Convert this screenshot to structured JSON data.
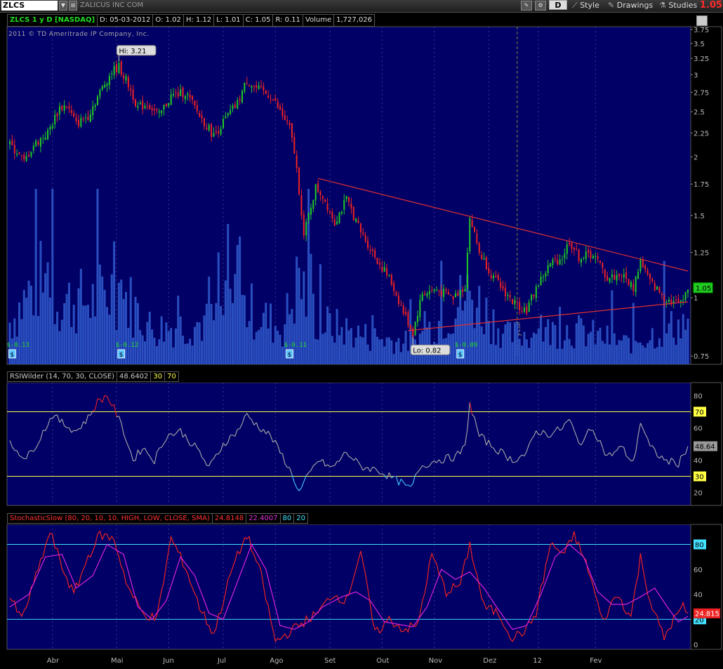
{
  "toolbar": {
    "symbol": "ZLCS",
    "company_name": "ZALICUS INC COM",
    "aggregation": "D",
    "style_label": "Style",
    "drawings_label": "Drawings",
    "studies_label": "Studies",
    "last_price": "1.05"
  },
  "info_bar": {
    "title": "ZLCS 1 y D [NASDAQ]",
    "date": "D: 05-03-2012",
    "open": "O: 1.02",
    "high": "H: 1.12",
    "low": "L: 1.01",
    "close": "C: 1.05",
    "range": "R: 0.11",
    "volume_label": "Volume",
    "volume_value": "1,727,026"
  },
  "copyright": "2011 © TD Ameritrade IP Company, Inc.",
  "colors": {
    "background": "#000066",
    "up": "#22cc22",
    "down": "#ee2222",
    "volume": "#2a4fc0",
    "trend": "#e03030",
    "rsi_line": "#aaaaaa",
    "overbought": "#ffff44",
    "stoch_k": "#ee2222",
    "stoch_d": "#dd22dd",
    "stoch_levels": "#44e0ff"
  },
  "rsi_legend": {
    "study": "RSIWilder (14, 70, 30, CLOSE)",
    "value": "48.6402",
    "oversold": "30",
    "overbought": "70"
  },
  "stoch_legend": {
    "study": "StochasticSlow (80, 20, 10, 10, HIGH, LOW, CLOSE, SMA)",
    "k_value": "24.8148",
    "d_value": "22.4007",
    "overbought": "80",
    "oversold": "20"
  },
  "chart_data": [
    {
      "type": "candlestick",
      "title": "ZLCS 1 y D [NASDAQ]",
      "x_labels": [
        "Abr",
        "Mai",
        "Jun",
        "Jul",
        "Ago",
        "Set",
        "Out",
        "Nov",
        "Dez",
        "12",
        "Fev"
      ],
      "year_marker": "2011 year",
      "y_ticks": [
        "3.75",
        "3.5",
        "3.25",
        "3",
        "2.75",
        "2.5",
        "2.25",
        "2",
        "1.75",
        "1.5",
        "1.25",
        "1",
        "0.75"
      ],
      "y_scale": "log",
      "y_range": [
        0.72,
        3.8
      ],
      "anchors": [
        {
          "d": 0,
          "p": 2.12
        },
        {
          "d": 3,
          "p": 2.05
        },
        {
          "d": 6,
          "p": 1.95
        },
        {
          "d": 10,
          "p": 2.12
        },
        {
          "d": 16,
          "p": 2.25
        },
        {
          "d": 21,
          "p": 2.55
        },
        {
          "d": 24,
          "p": 2.58
        },
        {
          "d": 28,
          "p": 2.35
        },
        {
          "d": 33,
          "p": 2.45
        },
        {
          "d": 38,
          "p": 2.75
        },
        {
          "d": 43,
          "p": 3.05
        },
        {
          "d": 46,
          "p": 3.12
        },
        {
          "d": 50,
          "p": 2.85
        },
        {
          "d": 54,
          "p": 2.55
        },
        {
          "d": 58,
          "p": 2.6
        },
        {
          "d": 63,
          "p": 2.45
        },
        {
          "d": 68,
          "p": 2.7
        },
        {
          "d": 74,
          "p": 2.75
        },
        {
          "d": 80,
          "p": 2.45
        },
        {
          "d": 86,
          "p": 2.22
        },
        {
          "d": 92,
          "p": 2.45
        },
        {
          "d": 96,
          "p": 2.6
        },
        {
          "d": 100,
          "p": 2.92
        },
        {
          "d": 104,
          "p": 2.8
        },
        {
          "d": 110,
          "p": 2.7
        },
        {
          "d": 114,
          "p": 2.5
        },
        {
          "d": 118,
          "p": 2.3
        },
        {
          "d": 120,
          "p": 2.05
        },
        {
          "d": 122,
          "p": 1.7
        },
        {
          "d": 124,
          "p": 1.35
        },
        {
          "d": 126,
          "p": 1.5
        },
        {
          "d": 129,
          "p": 1.72
        },
        {
          "d": 132,
          "p": 1.65
        },
        {
          "d": 137,
          "p": 1.45
        },
        {
          "d": 142,
          "p": 1.62
        },
        {
          "d": 148,
          "p": 1.38
        },
        {
          "d": 155,
          "p": 1.2
        },
        {
          "d": 160,
          "p": 1.1
        },
        {
          "d": 166,
          "p": 0.93
        },
        {
          "d": 170,
          "p": 0.84
        },
        {
          "d": 174,
          "p": 1.02
        },
        {
          "d": 180,
          "p": 1.04
        },
        {
          "d": 187,
          "p": 1.0
        },
        {
          "d": 192,
          "p": 1.06
        },
        {
          "d": 194,
          "p": 1.48
        },
        {
          "d": 198,
          "p": 1.25
        },
        {
          "d": 204,
          "p": 1.1
        },
        {
          "d": 212,
          "p": 0.98
        },
        {
          "d": 218,
          "p": 0.94
        },
        {
          "d": 222,
          "p": 1.05
        },
        {
          "d": 228,
          "p": 1.18
        },
        {
          "d": 233,
          "p": 1.22
        },
        {
          "d": 236,
          "p": 1.32
        },
        {
          "d": 240,
          "p": 1.22
        },
        {
          "d": 246,
          "p": 1.24
        },
        {
          "d": 252,
          "p": 1.1
        },
        {
          "d": 258,
          "p": 1.12
        },
        {
          "d": 263,
          "p": 1.05
        },
        {
          "d": 266,
          "p": 1.2
        },
        {
          "d": 270,
          "p": 1.08
        },
        {
          "d": 276,
          "p": 1.0
        },
        {
          "d": 282,
          "p": 0.97
        },
        {
          "d": 286,
          "p": 1.05
        }
      ],
      "volume_anchors": [
        {
          "d": 0,
          "v": 0.3
        },
        {
          "d": 12,
          "v": 0.6
        },
        {
          "d": 20,
          "v": 0.45
        },
        {
          "d": 35,
          "v": 0.45
        },
        {
          "d": 45,
          "v": 0.55
        },
        {
          "d": 60,
          "v": 0.25
        },
        {
          "d": 85,
          "v": 0.3
        },
        {
          "d": 95,
          "v": 0.45
        },
        {
          "d": 115,
          "v": 0.25
        },
        {
          "d": 122,
          "v": 0.6
        },
        {
          "d": 130,
          "v": 0.3
        },
        {
          "d": 150,
          "v": 0.2
        },
        {
          "d": 170,
          "v": 0.15
        },
        {
          "d": 194,
          "v": 0.5
        },
        {
          "d": 210,
          "v": 0.2
        },
        {
          "d": 236,
          "v": 0.25
        },
        {
          "d": 260,
          "v": 0.15
        },
        {
          "d": 286,
          "v": 0.3
        }
      ],
      "volume_spikes": [
        {
          "d": 18,
          "v": 1.0
        },
        {
          "d": 92,
          "v": 0.8
        },
        {
          "d": 96,
          "v": 0.68
        },
        {
          "d": 122,
          "v": 0.55
        },
        {
          "d": 194,
          "v": 0.42
        },
        {
          "d": 263,
          "v": 0.35
        }
      ],
      "annotations": [
        {
          "label": "Hi: 3.21",
          "d": 46,
          "p": 3.21
        },
        {
          "label": "Lo: 0.82",
          "d": 170,
          "p": 0.82
        }
      ],
      "dividends": [
        {
          "label": "$-0.13",
          "d": 1
        },
        {
          "label": "$-0.12",
          "d": 47
        },
        {
          "label": "$-0.11",
          "d": 118
        },
        {
          "label": "$-0.09",
          "d": 190
        }
      ],
      "trendlines": [
        {
          "from": {
            "d": 130,
            "p": 1.8
          },
          "to": {
            "d": 286,
            "p": 1.14
          }
        },
        {
          "from": {
            "d": 168,
            "p": 0.85
          },
          "to": {
            "d": 286,
            "p": 0.98
          }
        }
      ],
      "last_label": "1.05"
    },
    {
      "type": "line",
      "title": "RSIWilder (14, 70, 30, CLOSE)",
      "y_ticks": [
        "80",
        "60",
        "40",
        "20"
      ],
      "y_range": [
        12,
        88
      ],
      "levels": [
        {
          "value": 70,
          "label": "70"
        },
        {
          "value": 30,
          "label": "30"
        }
      ],
      "anchors": [
        {
          "d": 0,
          "v": 50
        },
        {
          "d": 7,
          "v": 41
        },
        {
          "d": 12,
          "v": 52
        },
        {
          "d": 18,
          "v": 68
        },
        {
          "d": 23,
          "v": 62
        },
        {
          "d": 28,
          "v": 58
        },
        {
          "d": 33,
          "v": 66
        },
        {
          "d": 37,
          "v": 76
        },
        {
          "d": 41,
          "v": 80
        },
        {
          "d": 44,
          "v": 72
        },
        {
          "d": 48,
          "v": 58
        },
        {
          "d": 52,
          "v": 40
        },
        {
          "d": 56,
          "v": 48
        },
        {
          "d": 61,
          "v": 40
        },
        {
          "d": 66,
          "v": 55
        },
        {
          "d": 72,
          "v": 58
        },
        {
          "d": 80,
          "v": 45
        },
        {
          "d": 84,
          "v": 35
        },
        {
          "d": 90,
          "v": 50
        },
        {
          "d": 96,
          "v": 58
        },
        {
          "d": 100,
          "v": 68
        },
        {
          "d": 104,
          "v": 62
        },
        {
          "d": 110,
          "v": 55
        },
        {
          "d": 116,
          "v": 40
        },
        {
          "d": 120,
          "v": 28
        },
        {
          "d": 122,
          "v": 20
        },
        {
          "d": 125,
          "v": 28
        },
        {
          "d": 130,
          "v": 40
        },
        {
          "d": 136,
          "v": 35
        },
        {
          "d": 142,
          "v": 45
        },
        {
          "d": 148,
          "v": 36
        },
        {
          "d": 155,
          "v": 34
        },
        {
          "d": 160,
          "v": 30
        },
        {
          "d": 165,
          "v": 26
        },
        {
          "d": 169,
          "v": 22
        },
        {
          "d": 173,
          "v": 36
        },
        {
          "d": 180,
          "v": 40
        },
        {
          "d": 188,
          "v": 42
        },
        {
          "d": 192,
          "v": 48
        },
        {
          "d": 194,
          "v": 75
        },
        {
          "d": 198,
          "v": 55
        },
        {
          "d": 204,
          "v": 48
        },
        {
          "d": 212,
          "v": 40
        },
        {
          "d": 218,
          "v": 44
        },
        {
          "d": 222,
          "v": 58
        },
        {
          "d": 228,
          "v": 56
        },
        {
          "d": 233,
          "v": 60
        },
        {
          "d": 236,
          "v": 65
        },
        {
          "d": 240,
          "v": 50
        },
        {
          "d": 246,
          "v": 60
        },
        {
          "d": 252,
          "v": 42
        },
        {
          "d": 258,
          "v": 48
        },
        {
          "d": 263,
          "v": 38
        },
        {
          "d": 266,
          "v": 64
        },
        {
          "d": 270,
          "v": 48
        },
        {
          "d": 276,
          "v": 40
        },
        {
          "d": 282,
          "v": 38
        },
        {
          "d": 286,
          "v": 48.64
        }
      ],
      "last_label": "48.64"
    },
    {
      "type": "line",
      "title": "StochasticSlow (80, 20, 10, 10, HIGH, LOW, CLOSE, SMA)",
      "y_ticks": [
        "80",
        "60",
        "40",
        "20",
        "0"
      ],
      "y_range": [
        -4,
        96
      ],
      "levels": [
        {
          "value": 80,
          "label": "80"
        },
        {
          "value": 20,
          "label": "20"
        }
      ],
      "series": [
        {
          "name": "SlowK",
          "anchors": [
            {
              "d": 0,
              "v": 38
            },
            {
              "d": 5,
              "v": 20
            },
            {
              "d": 10,
              "v": 48
            },
            {
              "d": 17,
              "v": 90
            },
            {
              "d": 22,
              "v": 62
            },
            {
              "d": 27,
              "v": 40
            },
            {
              "d": 33,
              "v": 70
            },
            {
              "d": 38,
              "v": 88
            },
            {
              "d": 44,
              "v": 84
            },
            {
              "d": 50,
              "v": 45
            },
            {
              "d": 56,
              "v": 25
            },
            {
              "d": 62,
              "v": 20
            },
            {
              "d": 68,
              "v": 85
            },
            {
              "d": 74,
              "v": 62
            },
            {
              "d": 80,
              "v": 30
            },
            {
              "d": 86,
              "v": 8
            },
            {
              "d": 94,
              "v": 62
            },
            {
              "d": 100,
              "v": 88
            },
            {
              "d": 106,
              "v": 55
            },
            {
              "d": 112,
              "v": 2
            },
            {
              "d": 118,
              "v": 10
            },
            {
              "d": 124,
              "v": 18
            },
            {
              "d": 130,
              "v": 25
            },
            {
              "d": 136,
              "v": 40
            },
            {
              "d": 142,
              "v": 35
            },
            {
              "d": 148,
              "v": 75
            },
            {
              "d": 154,
              "v": 8
            },
            {
              "d": 160,
              "v": 20
            },
            {
              "d": 166,
              "v": 12
            },
            {
              "d": 172,
              "v": 15
            },
            {
              "d": 178,
              "v": 72
            },
            {
              "d": 184,
              "v": 42
            },
            {
              "d": 190,
              "v": 48
            },
            {
              "d": 194,
              "v": 80
            },
            {
              "d": 200,
              "v": 30
            },
            {
              "d": 206,
              "v": 25
            },
            {
              "d": 212,
              "v": 5
            },
            {
              "d": 218,
              "v": 12
            },
            {
              "d": 222,
              "v": 25
            },
            {
              "d": 228,
              "v": 80
            },
            {
              "d": 234,
              "v": 72
            },
            {
              "d": 238,
              "v": 88
            },
            {
              "d": 244,
              "v": 60
            },
            {
              "d": 250,
              "v": 18
            },
            {
              "d": 256,
              "v": 40
            },
            {
              "d": 262,
              "v": 22
            },
            {
              "d": 266,
              "v": 70
            },
            {
              "d": 270,
              "v": 35
            },
            {
              "d": 276,
              "v": 5
            },
            {
              "d": 280,
              "v": 20
            },
            {
              "d": 284,
              "v": 30
            },
            {
              "d": 286,
              "v": 24.8
            }
          ]
        },
        {
          "name": "SlowD",
          "anchors": [
            {
              "d": 0,
              "v": 30
            },
            {
              "d": 8,
              "v": 40
            },
            {
              "d": 15,
              "v": 70
            },
            {
              "d": 22,
              "v": 72
            },
            {
              "d": 28,
              "v": 45
            },
            {
              "d": 35,
              "v": 55
            },
            {
              "d": 41,
              "v": 80
            },
            {
              "d": 48,
              "v": 72
            },
            {
              "d": 54,
              "v": 30
            },
            {
              "d": 60,
              "v": 20
            },
            {
              "d": 66,
              "v": 35
            },
            {
              "d": 72,
              "v": 70
            },
            {
              "d": 78,
              "v": 55
            },
            {
              "d": 84,
              "v": 25
            },
            {
              "d": 90,
              "v": 20
            },
            {
              "d": 96,
              "v": 50
            },
            {
              "d": 102,
              "v": 80
            },
            {
              "d": 108,
              "v": 60
            },
            {
              "d": 114,
              "v": 15
            },
            {
              "d": 120,
              "v": 12
            },
            {
              "d": 126,
              "v": 18
            },
            {
              "d": 132,
              "v": 30
            },
            {
              "d": 140,
              "v": 38
            },
            {
              "d": 146,
              "v": 42
            },
            {
              "d": 152,
              "v": 35
            },
            {
              "d": 158,
              "v": 18
            },
            {
              "d": 164,
              "v": 16
            },
            {
              "d": 170,
              "v": 14
            },
            {
              "d": 176,
              "v": 30
            },
            {
              "d": 182,
              "v": 60
            },
            {
              "d": 188,
              "v": 52
            },
            {
              "d": 194,
              "v": 58
            },
            {
              "d": 200,
              "v": 45
            },
            {
              "d": 206,
              "v": 28
            },
            {
              "d": 212,
              "v": 12
            },
            {
              "d": 218,
              "v": 15
            },
            {
              "d": 224,
              "v": 40
            },
            {
              "d": 230,
              "v": 70
            },
            {
              "d": 236,
              "v": 80
            },
            {
              "d": 242,
              "v": 70
            },
            {
              "d": 248,
              "v": 42
            },
            {
              "d": 254,
              "v": 32
            },
            {
              "d": 260,
              "v": 32
            },
            {
              "d": 266,
              "v": 38
            },
            {
              "d": 272,
              "v": 45
            },
            {
              "d": 278,
              "v": 28
            },
            {
              "d": 282,
              "v": 18
            },
            {
              "d": 286,
              "v": 22.4
            }
          ]
        }
      ],
      "last_label": "24.815"
    }
  ]
}
